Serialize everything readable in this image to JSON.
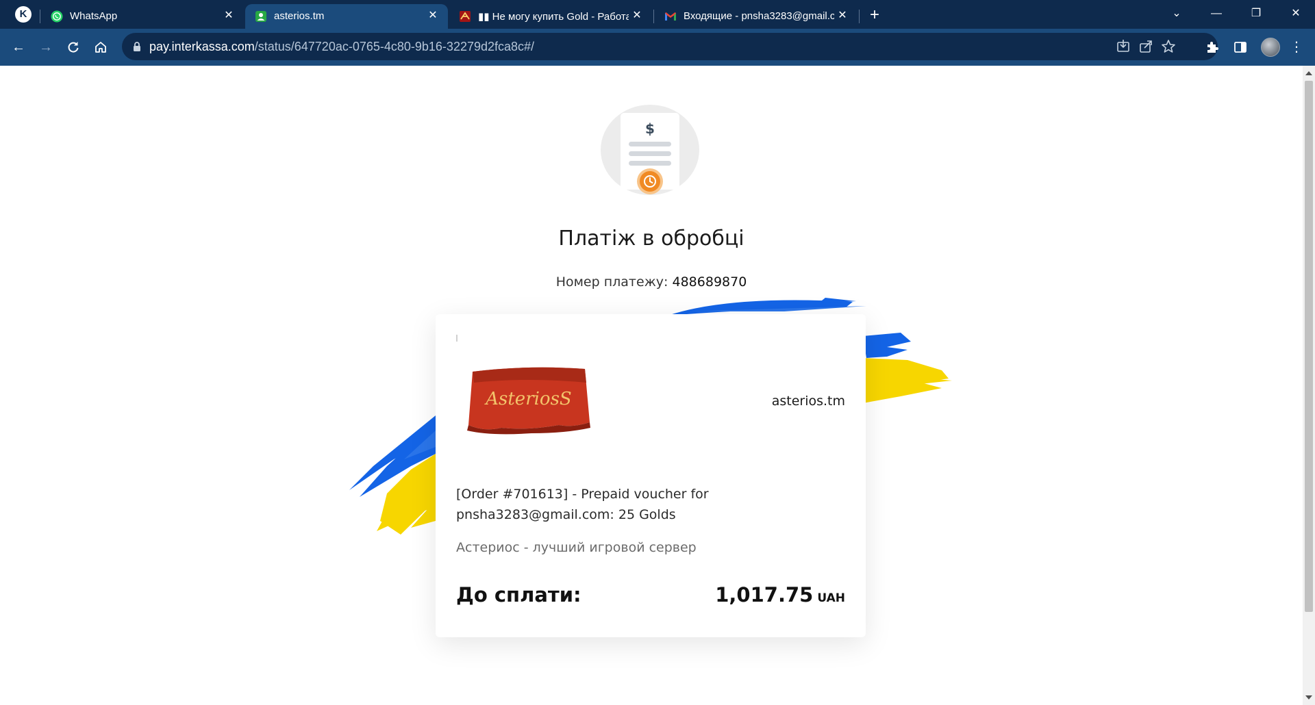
{
  "browser": {
    "tabs": [
      {
        "title": "WhatsApp",
        "icon": "whatsapp-icon"
      },
      {
        "title": "asterios.tm",
        "icon": "asterios-favicon",
        "active": true
      },
      {
        "title": "▮▮ Не могу купить Gold - Работа",
        "icon": "asterios-forum-favicon"
      },
      {
        "title": "Входящие - pnsha3283@gmail.c",
        "icon": "gmail-icon"
      }
    ],
    "url_host": "pay.interkassa.com",
    "url_path": "/status/647720ac-0765-4c80-9b16-32279d2fca8c#/"
  },
  "page": {
    "status_title": "Платіж в обробці",
    "payment_number_label": "Номер платежу:",
    "payment_number": "488689870",
    "merchant_logo_text": "AsteriosS",
    "merchant_name": "asterios.tm",
    "order_description": "[Order #701613] - Prepaid voucher for pnsha3283@gmail.com: 25 Golds",
    "merchant_tagline": "Астериос - лучший игровой сервер",
    "total_label": "До сплати:",
    "total_amount": "1,017.75",
    "currency": "UAH"
  },
  "colors": {
    "tabstrip": "#0e2a4d",
    "toolbar": "#1b4b7c",
    "flag_blue": "#1464e6",
    "flag_yellow": "#f7d600",
    "status_orange": "#f08a24"
  }
}
